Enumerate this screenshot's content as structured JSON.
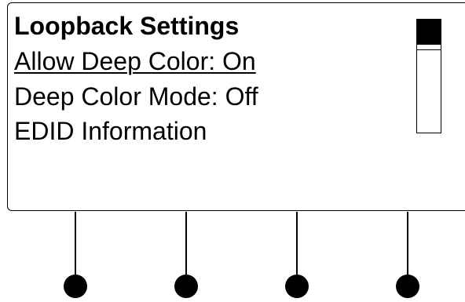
{
  "screen": {
    "title": "Loopback Settings",
    "items": [
      {
        "label": "Allow Deep Color: On",
        "selected": true
      },
      {
        "label": "Deep Color Mode: Off",
        "selected": false
      },
      {
        "label": "EDID Information",
        "selected": false
      }
    ]
  },
  "scrollbar": {
    "position": "top"
  },
  "softkeys": {
    "count": 4
  }
}
